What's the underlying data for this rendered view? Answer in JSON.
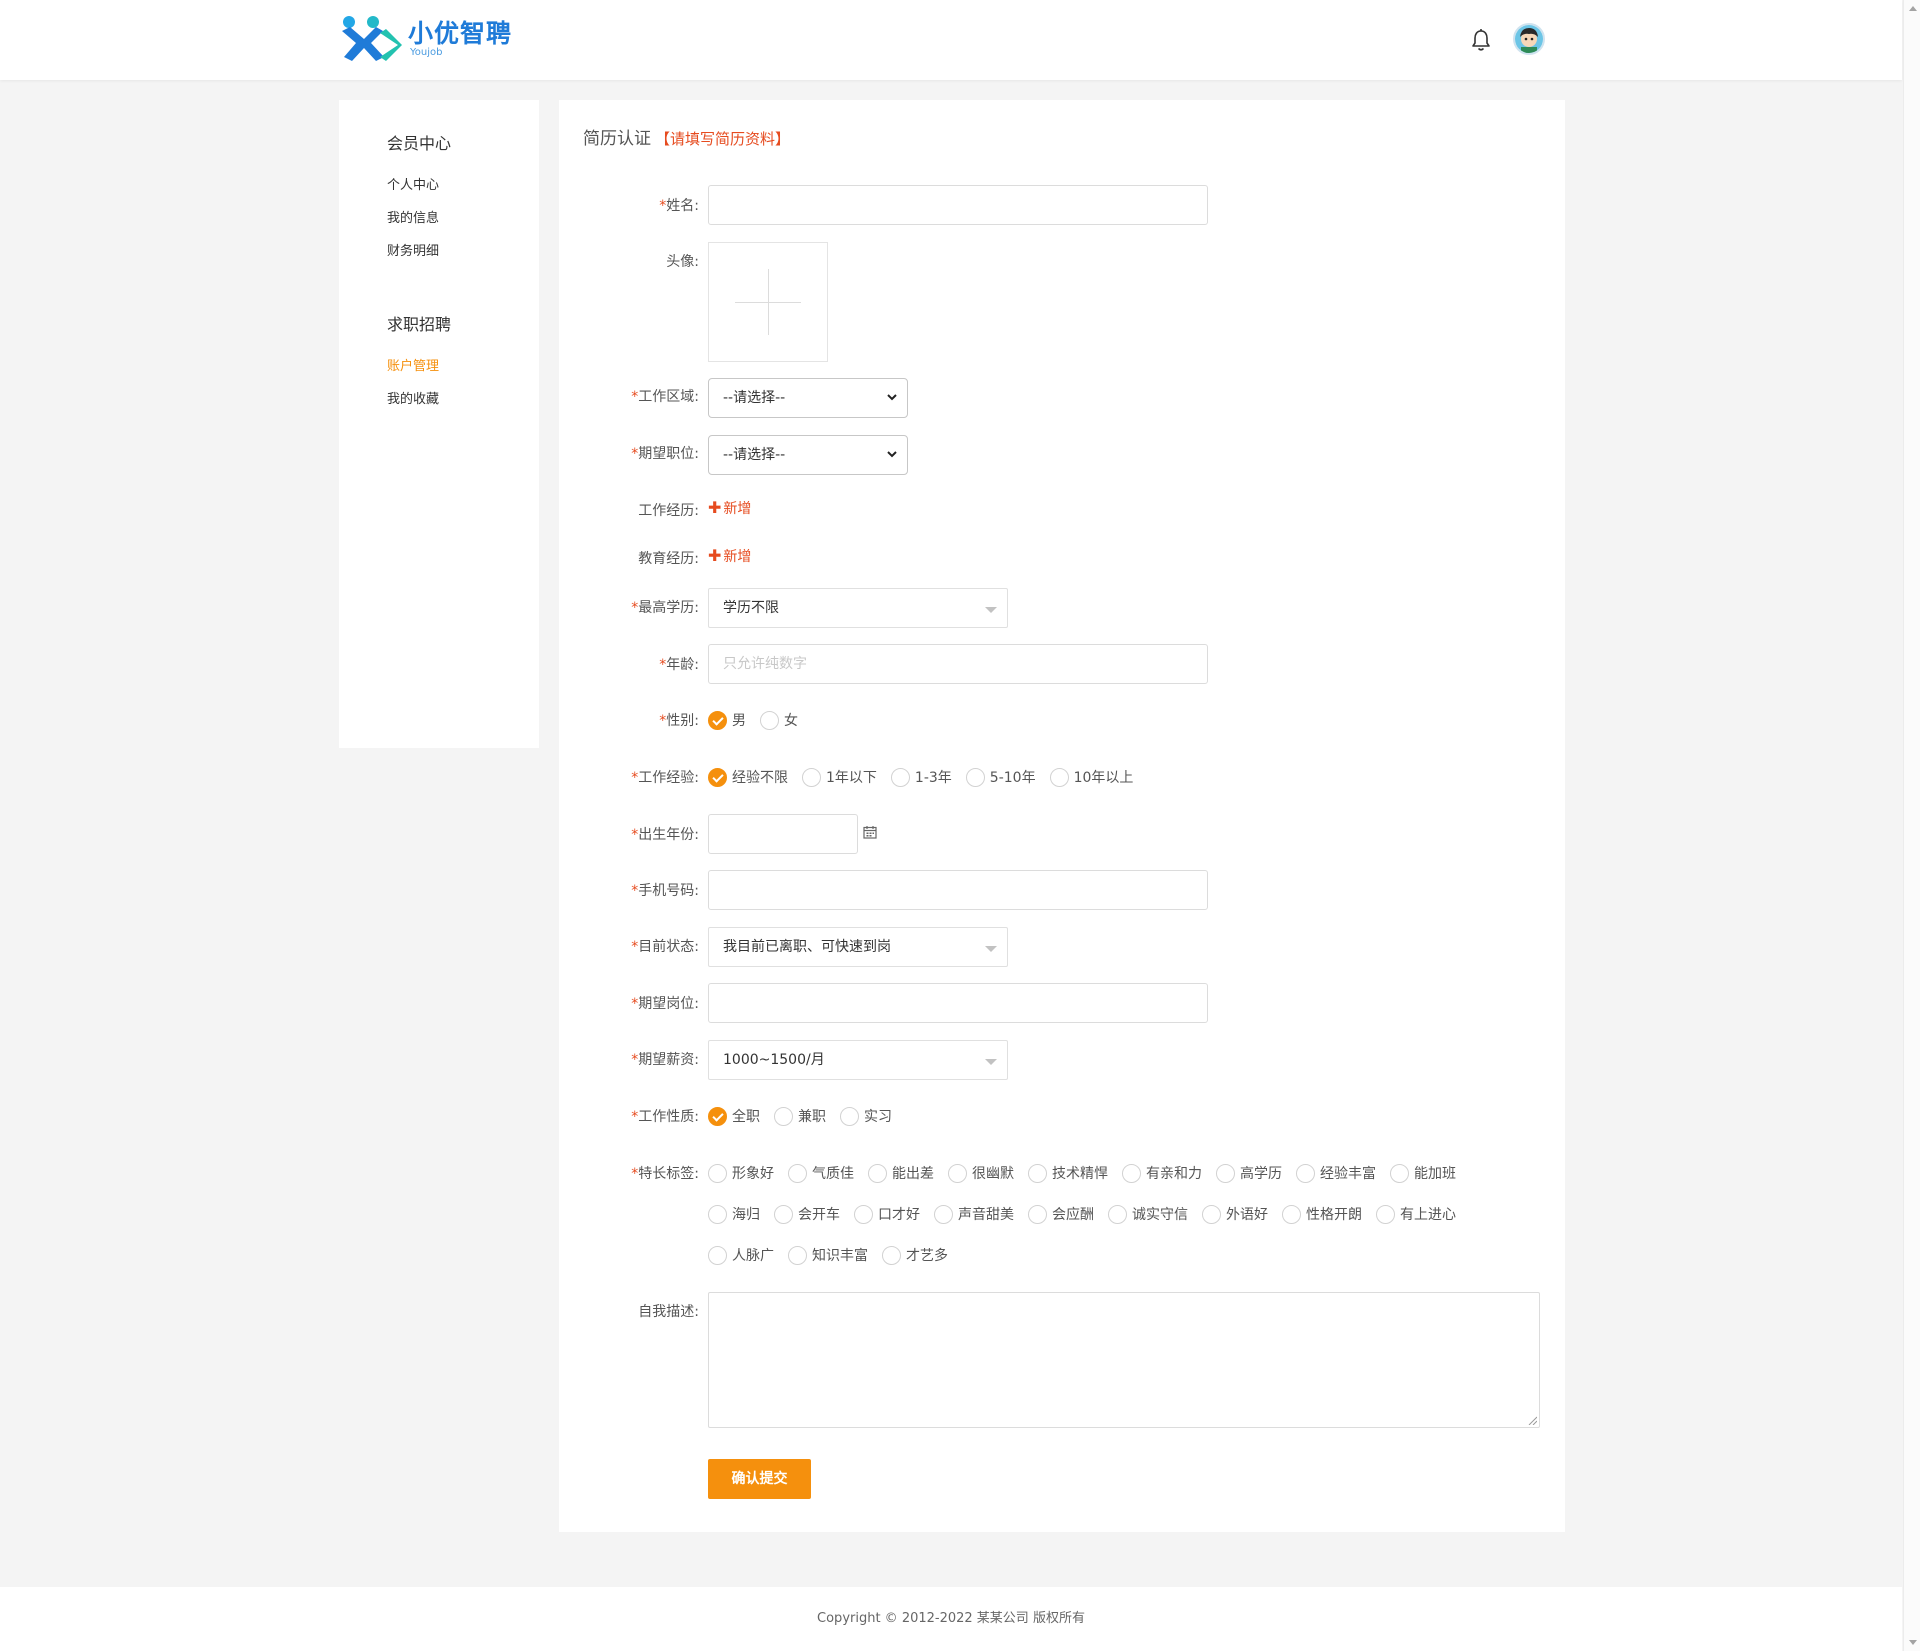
{
  "header": {
    "logo_name": "小优智聘",
    "logo_sub": "Youjob"
  },
  "sidebar": {
    "group1": {
      "title": "会员中心",
      "items": [
        "个人中心",
        "我的信息",
        "财务明细"
      ]
    },
    "group2": {
      "title": "求职招聘",
      "items": [
        "账户管理",
        "我的收藏"
      ]
    },
    "active": "账户管理"
  },
  "page": {
    "title": "简历认证",
    "hint": "【请填写简历资料】"
  },
  "form": {
    "name": {
      "label": "姓名:",
      "required": "*",
      "value": ""
    },
    "avatar": {
      "label": "头像:"
    },
    "region": {
      "label": "工作区域:",
      "required": "*",
      "value": "--请选择--"
    },
    "position": {
      "label": "期望职位:",
      "required": "*",
      "value": "--请选择--"
    },
    "work_exp": {
      "label": "工作经历:",
      "add": "新增"
    },
    "edu_exp": {
      "label": "教育经历:",
      "add": "新增"
    },
    "education": {
      "label": "最高学历:",
      "required": "*",
      "value": "学历不限"
    },
    "age": {
      "label": "年龄:",
      "required": "*",
      "placeholder": "只允许纯数字"
    },
    "gender": {
      "label": "性别:",
      "required": "*",
      "options": [
        "男",
        "女"
      ],
      "selected": "男"
    },
    "experience": {
      "label": "工作经验:",
      "required": "*",
      "options": [
        "经验不限",
        "1年以下",
        "1-3年",
        "5-10年",
        "10年以上"
      ],
      "selected": "经验不限"
    },
    "birth_year": {
      "label": "出生年份:",
      "required": "*",
      "value": ""
    },
    "phone": {
      "label": "手机号码:",
      "required": "*",
      "value": ""
    },
    "status": {
      "label": "目前状态:",
      "required": "*",
      "value": "我目前已离职、可快速到岗"
    },
    "expected_post": {
      "label": "期望岗位:",
      "required": "*",
      "value": ""
    },
    "salary": {
      "label": "期望薪资:",
      "required": "*",
      "value": "1000~1500/月"
    },
    "job_type": {
      "label": "工作性质:",
      "required": "*",
      "options": [
        "全职",
        "兼职",
        "实习"
      ],
      "selected": "全职"
    },
    "tags": {
      "label": "特长标签:",
      "required": "*",
      "row1": [
        "形象好",
        "气质佳",
        "能出差",
        "很幽默",
        "技术精悍",
        "有亲和力",
        "高学历",
        "经验丰富",
        "能加班"
      ],
      "row2": [
        "海归",
        "会开车",
        "口才好",
        "声音甜美",
        "会应酬",
        "诚实守信",
        "外语好",
        "性格开朗",
        "有上进心"
      ],
      "row3": [
        "人脉广",
        "知识丰富",
        "才艺多"
      ]
    },
    "intro": {
      "label": "自我描述:"
    },
    "submit": "确认提交"
  },
  "footer": {
    "copyright": "Copyright © 2012-2022 某某公司 版权所有"
  },
  "colors": {
    "accent": "#f5900d",
    "hint_red": "#e64b1f",
    "logo_blue": "#1f7bd8"
  }
}
